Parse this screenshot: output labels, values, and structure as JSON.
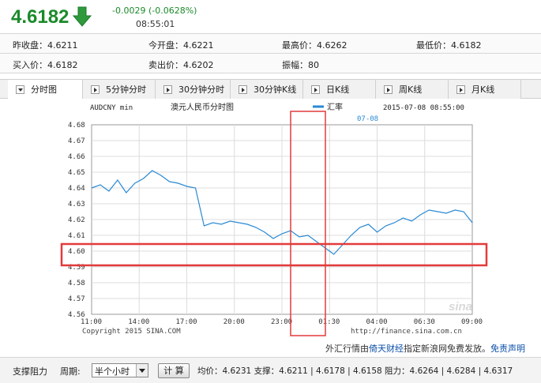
{
  "quote": {
    "price": "4.6182",
    "change": "-0.0029 (-0.0628%)",
    "time": "08:55:01"
  },
  "stats": {
    "prev_close": "昨收盘：4.6211",
    "open": "今开盘：4.6221",
    "high": "最高价：4.6262",
    "low": "最低价：4.6182",
    "bid": "买入价：4.6182",
    "ask": "卖出价：4.6202",
    "amplitude": "振幅：80"
  },
  "tabs": [
    {
      "label": "分时图"
    },
    {
      "label": "5分钟分时"
    },
    {
      "label": "30分钟分时"
    },
    {
      "label": "30分钟K线"
    },
    {
      "label": "日K线"
    },
    {
      "label": "周K线"
    },
    {
      "label": "月K线"
    }
  ],
  "chart_header": {
    "symbol": "AUDCNY min",
    "title": "澳元人民币分时图",
    "legend": "汇率",
    "datetime": "2015-07-08 08:55:00",
    "date_marker": "07-08",
    "copyright": "Copyright 2015 SINA.COM",
    "url": "http://finance.sina.com.cn",
    "watermark": "sina"
  },
  "chart_data": {
    "type": "line",
    "title": "澳元人民币分时图",
    "series": [
      {
        "name": "汇率",
        "x": [
          "11:00",
          "11:30",
          "12:00",
          "12:30",
          "13:00",
          "13:30",
          "14:00",
          "14:30",
          "15:00",
          "15:30",
          "16:00",
          "16:30",
          "17:00",
          "17:30",
          "18:00",
          "18:30",
          "19:00",
          "19:30",
          "20:00",
          "20:30",
          "21:00",
          "21:30",
          "22:00",
          "22:30",
          "23:00",
          "23:30",
          "00:00",
          "00:30",
          "01:00",
          "01:30",
          "02:00",
          "02:30",
          "03:00",
          "03:30",
          "04:00",
          "04:30",
          "05:00",
          "05:30",
          "06:00",
          "06:30",
          "07:00",
          "07:30",
          "08:00",
          "08:30",
          "08:55"
        ],
        "values": [
          4.64,
          4.642,
          4.638,
          4.645,
          4.637,
          4.643,
          4.646,
          4.651,
          4.648,
          4.644,
          4.643,
          4.641,
          4.64,
          4.616,
          4.618,
          4.617,
          4.619,
          4.618,
          4.617,
          4.615,
          4.612,
          4.608,
          4.611,
          4.613,
          4.609,
          4.61,
          4.606,
          4.602,
          4.598,
          4.604,
          4.61,
          4.615,
          4.617,
          4.612,
          4.616,
          4.618,
          4.621,
          4.619,
          4.623,
          4.626,
          4.625,
          4.624,
          4.626,
          4.625,
          4.618
        ]
      }
    ],
    "x_ticks": [
      "11:00",
      "14:00",
      "17:00",
      "20:00",
      "23:00",
      "01:30",
      "04:00",
      "06:30",
      "09:00"
    ],
    "y_ticks": [
      "4.68",
      "4.67",
      "4.66",
      "4.65",
      "4.64",
      "4.63",
      "4.62",
      "4.61",
      "4.60",
      "4.59",
      "4.58",
      "4.57",
      "4.56"
    ],
    "ylim": [
      4.56,
      4.68
    ],
    "grid": true,
    "line_color": "#2a8ad4",
    "highlight_color": "#e23b3b"
  },
  "promo": {
    "prefix": "外汇行情由",
    "brand": "倚天财经",
    "middle": "指定新浪网免费发放。",
    "disclaimer": "免责声明"
  },
  "bottom": {
    "label": "支撑阻力",
    "period_label": "周期:",
    "period_value": "半个小时",
    "calc_button": "计 算",
    "summary": "均价：4.6231  支撑：4.6211 | 4.6178 | 4.6158  阻力：4.6264 | 4.6284 | 4.6317"
  }
}
